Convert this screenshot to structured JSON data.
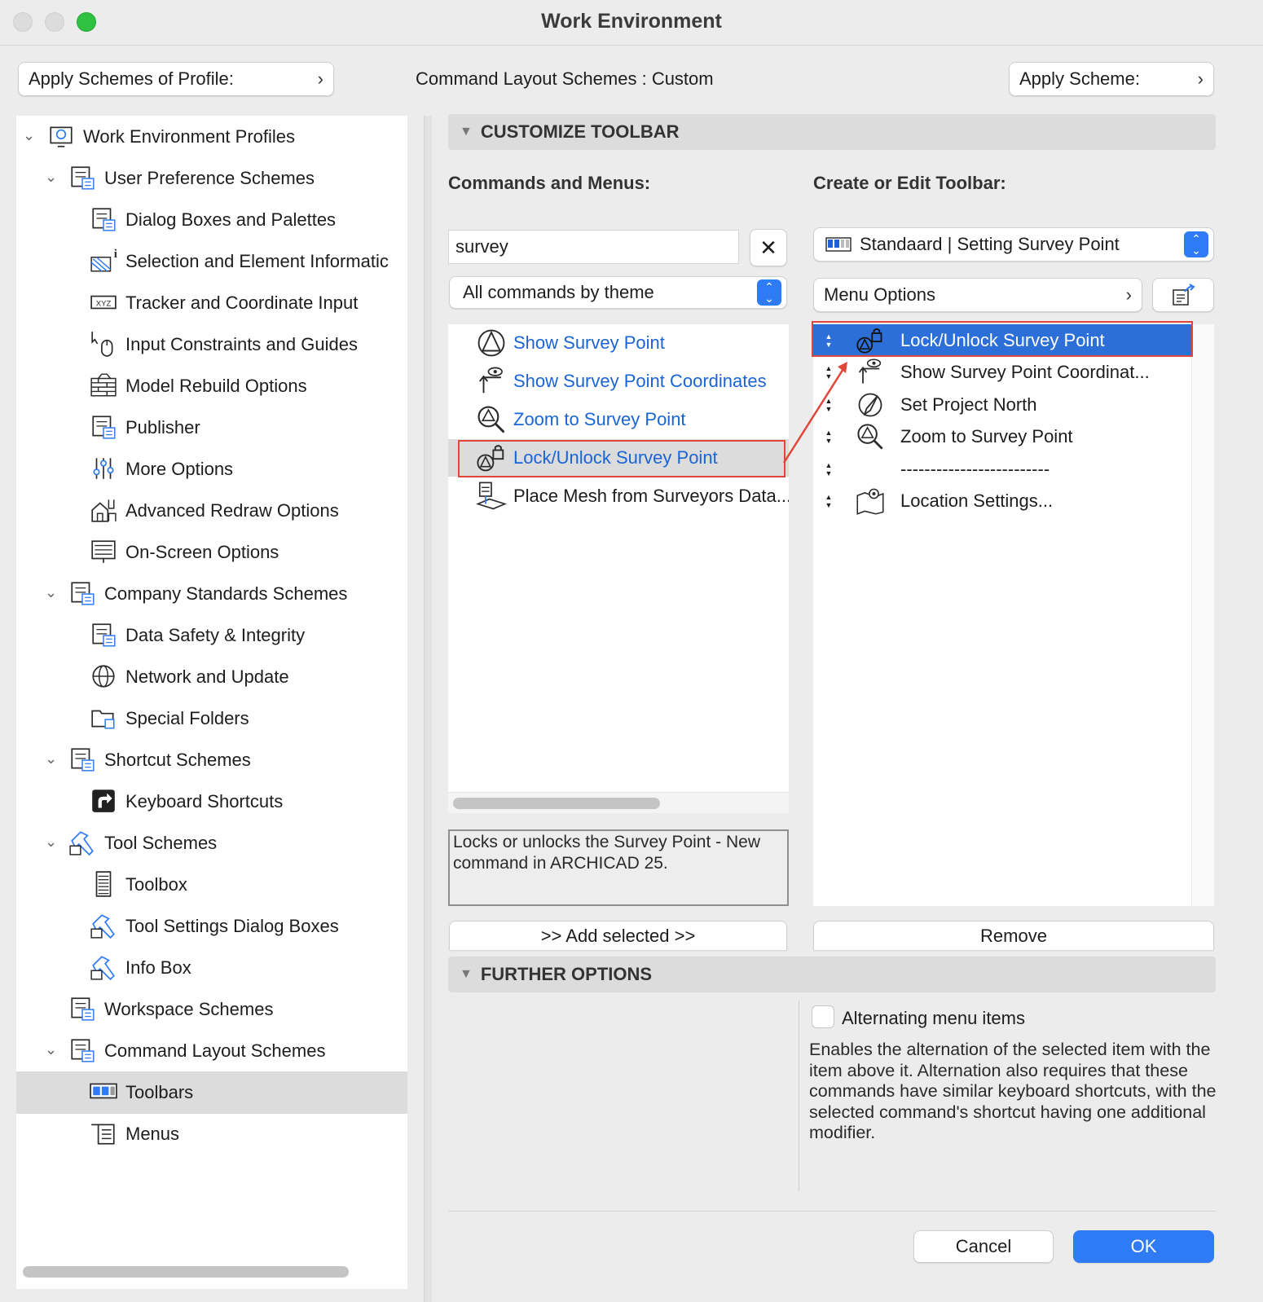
{
  "window": {
    "title": "Work Environment",
    "traffic_lights": [
      "#dcdcdc",
      "#dcdcdc",
      "#2fc142"
    ]
  },
  "top_bar": {
    "apply_profile_label": "Apply Schemes of Profile:",
    "scheme_label": "Command Layout Schemes : ",
    "scheme_value": "Custom",
    "apply_scheme_label": "Apply Scheme:"
  },
  "tree": {
    "items": [
      {
        "label": "Work Environment Profiles",
        "icon": "profiles-icon"
      },
      {
        "label": "User Preference Schemes",
        "icon": "user-preference-icon"
      },
      {
        "label": "Dialog Boxes and Palettes",
        "icon": "dialog-boxes-icon"
      },
      {
        "label": "Selection and Element Informatic",
        "icon": "selection-icon"
      },
      {
        "label": "Tracker and Coordinate Input",
        "icon": "xyz-icon"
      },
      {
        "label": "Input Constraints and Guides",
        "icon": "mouse-cursor-icon"
      },
      {
        "label": "Model Rebuild Options",
        "icon": "brick-wall-icon"
      },
      {
        "label": "Publisher",
        "icon": "publisher-icon"
      },
      {
        "label": "More Options",
        "icon": "sliders-icon"
      },
      {
        "label": "Advanced Redraw Options",
        "icon": "redraw-house-icon"
      },
      {
        "label": "On-Screen Options",
        "icon": "monitor-icon"
      },
      {
        "label": "Company Standards Schemes",
        "icon": "company-standards-icon"
      },
      {
        "label": "Data Safety & Integrity",
        "icon": "data-safety-icon"
      },
      {
        "label": "Network and Update",
        "icon": "globe-icon"
      },
      {
        "label": "Special Folders",
        "icon": "folder-icon"
      },
      {
        "label": "Shortcut Schemes",
        "icon": "shortcut-schemes-icon"
      },
      {
        "label": "Keyboard Shortcuts",
        "icon": "shortcut-arrow-icon"
      },
      {
        "label": "Tool Schemes",
        "icon": "tool-schemes-icon"
      },
      {
        "label": "Toolbox",
        "icon": "toolbox-icon"
      },
      {
        "label": "Tool Settings Dialog Boxes",
        "icon": "tool-settings-icon"
      },
      {
        "label": "Info Box",
        "icon": "info-box-icon"
      },
      {
        "label": "Workspace Schemes",
        "icon": "workspace-icon"
      },
      {
        "label": "Command Layout Schemes",
        "icon": "command-layout-icon"
      },
      {
        "label": "Toolbars",
        "icon": "toolbar-icon"
      },
      {
        "label": "Menus",
        "icon": "menus-icon"
      }
    ]
  },
  "customize": {
    "header": "CUSTOMIZE TOOLBAR",
    "commands_label": "Commands and Menus:",
    "create_label": "Create or Edit Toolbar:",
    "search_value": "survey",
    "theme_select": "All commands by theme",
    "toolbar_select": "Standaard | Setting Survey Point",
    "menu_options": "Menu Options",
    "commands": [
      {
        "label": "Show Survey Point",
        "icon": "survey-point-icon"
      },
      {
        "label": "Show Survey Point Coordinates",
        "icon": "survey-coordinates-icon"
      },
      {
        "label": "Zoom to Survey Point",
        "icon": "zoom-survey-icon"
      },
      {
        "label": "Lock/Unlock Survey Point",
        "icon": "lock-survey-icon"
      },
      {
        "label": "Place Mesh from Surveyors Data...",
        "icon": "mesh-survey-icon"
      }
    ],
    "toolbar_items": [
      {
        "label": "Lock/Unlock Survey Point",
        "icon": "lock-survey-icon"
      },
      {
        "label": "Show Survey Point Coordinat...",
        "icon": "survey-coordinates-icon"
      },
      {
        "label": "Set Project North",
        "icon": "compass-icon"
      },
      {
        "label": "Zoom to Survey Point",
        "icon": "zoom-survey-icon"
      },
      {
        "label": "-------------------------",
        "icon": ""
      },
      {
        "label": "Location Settings...",
        "icon": "location-map-icon"
      }
    ],
    "description": "Locks or unlocks the Survey Point - New command in ARCHICAD 25.",
    "add_button": ">> Add selected >>",
    "remove_button": "Remove"
  },
  "further": {
    "header": "FURTHER OPTIONS",
    "checkbox_label": "Alternating menu items",
    "checkbox_checked": false,
    "description": "Enables the alternation of the selected item with the item above it. Alternation also requires that these commands have similar keyboard shortcuts, with the selected command's shortcut having one additional modifier."
  },
  "footer": {
    "cancel": "Cancel",
    "ok": "OK"
  },
  "colors": {
    "accent": "#2f7bf6",
    "link": "#1a64d6",
    "selection": "#2d6fd8",
    "highlight_border": "#e0473a"
  }
}
